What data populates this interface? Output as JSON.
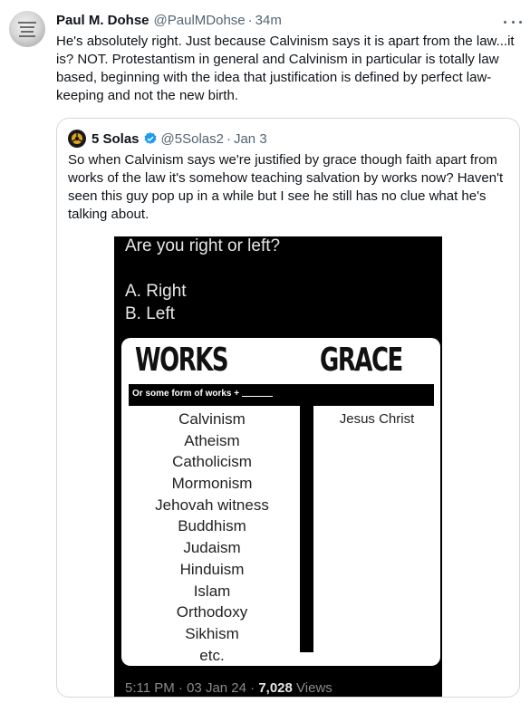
{
  "tweet": {
    "author_name": "Paul M. Dohse",
    "author_handle": "@PaulMDohse",
    "separator": "·",
    "timestamp": "34m",
    "text": "He's absolutely right. Just because Calvinism says it is apart from the law...it is? NOT. Protestantism in general and Calvinism in particular is totally law based, beginning with the idea that justification is defined by perfect law-keeping and not the new birth."
  },
  "quoted_tweet": {
    "author_name": "5 Solas",
    "author_handle": "@5Solas2",
    "separator": "·",
    "date": "Jan 3",
    "text": "So when Calvinism says we're justified by grace though faith apart from works of the law it's somehow teaching salvation by works now? Haven't seen this guy pop up in a while but I see he still has no clue what he's talking about."
  },
  "media": {
    "question": "Are you right or left?",
    "option_a": "A. Right",
    "option_b": "B. Left",
    "card": {
      "left_title": "WORKS",
      "right_title": "GRACE",
      "subtitle": "Or some form of works +",
      "works_items": [
        "Calvinism",
        "Atheism",
        "Catholicism",
        "Mormonism",
        "Jehovah witness",
        "Buddhism",
        "Judaism",
        "Hinduism",
        "Islam",
        "Orthodoxy",
        "Sikhism",
        "etc."
      ],
      "grace_items": [
        "Jesus Christ"
      ]
    },
    "footer": {
      "time": "5:11 PM",
      "date": "03 Jan 24",
      "views_count": "7,028",
      "views_label": "Views",
      "separator": "·"
    }
  },
  "icons": {
    "more": "more-horizontal-icon",
    "verified": "verified-badge-icon",
    "verified_color": "#1d9bf0"
  },
  "colors": {
    "text_primary": "#0f1419",
    "text_secondary": "#536471",
    "border": "#cfd9de"
  }
}
